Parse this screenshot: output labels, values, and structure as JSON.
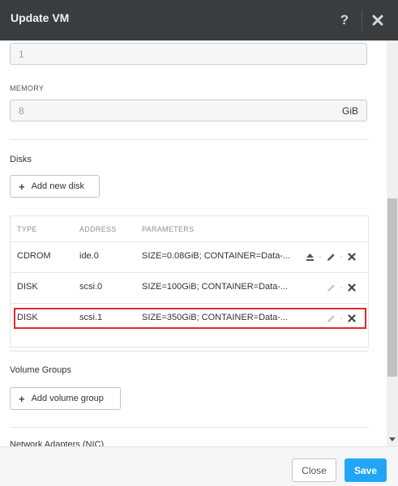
{
  "header": {
    "title": "Update VM",
    "help_label": "?",
    "help_icon": "question-icon",
    "close_icon": "close-icon"
  },
  "cores": {
    "value": "1"
  },
  "memory": {
    "label": "MEMORY",
    "value": "8",
    "unit": "GiB"
  },
  "disks": {
    "title": "Disks",
    "add_button": "Add new disk",
    "columns": [
      "TYPE",
      "ADDRESS",
      "PARAMETERS"
    ],
    "rows": [
      {
        "type": "CDROM",
        "address": "ide.0",
        "parameters": "SIZE=0.08GiB; CONTAINER=Data-...",
        "icons": [
          "eject-icon",
          "edit-icon",
          "delete-icon"
        ]
      },
      {
        "type": "DISK",
        "address": "scsi.0",
        "parameters": "SIZE=100GiB; CONTAINER=Data-...",
        "icons": [
          "edit-icon",
          "delete-icon"
        ]
      },
      {
        "type": "DISK",
        "address": "scsi.1",
        "parameters": "SIZE=350GiB; CONTAINER=Data-...",
        "icons": [
          "edit-icon",
          "delete-icon"
        ],
        "highlighted": true
      }
    ]
  },
  "volume_groups": {
    "title": "Volume Groups",
    "add_button": "Add volume group"
  },
  "network": {
    "title": "Network Adapters (NIC)"
  },
  "footer": {
    "close_label": "Close",
    "save_label": "Save"
  },
  "colors": {
    "header_bg": "#3a3d40",
    "accent": "#22a5f7",
    "highlight": "#e0292f"
  }
}
